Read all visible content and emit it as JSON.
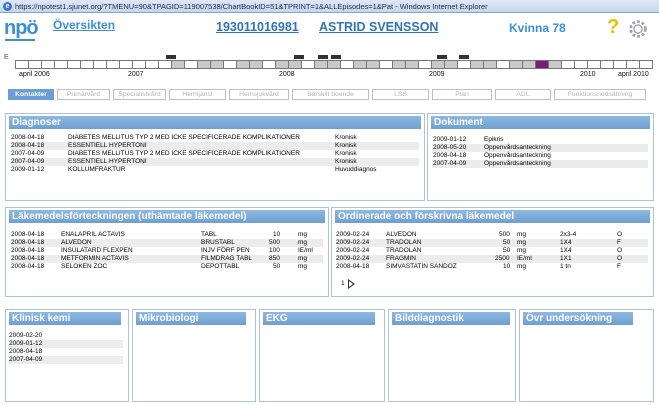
{
  "window": {
    "title": "https://npotest1.sjunet.org/?TMENU=90&TPAGID=119007538/ChartBookID=51&TPRINT=1&ALLEpisodes=1&Pat - Windows Internet Explorer"
  },
  "header": {
    "logo": "npö",
    "overview_link": "Översikten",
    "patient_id": "193011016981",
    "patient_name": "ASTRID SVENSSON",
    "gender_age": "Kvinna 78",
    "help_icon": "question-mark",
    "settings_icon": "gear"
  },
  "timeline": {
    "expand": "E",
    "years": [
      "april 2006",
      "2007",
      "2008",
      "2009",
      "2010",
      "april 2010"
    ],
    "highlight_color": "#7a1a7a"
  },
  "tabs": [
    {
      "label": "Kontakter",
      "active": true
    },
    {
      "label": "Primärvård",
      "active": false
    },
    {
      "label": "Specialistvård",
      "active": false
    },
    {
      "label": "Hemtjänst",
      "active": false
    },
    {
      "label": "Hemsjukvård",
      "active": false
    },
    {
      "label": "Särskilt boende",
      "active": false
    },
    {
      "label": "LSS",
      "active": false
    },
    {
      "label": "Plan",
      "active": false
    },
    {
      "label": "ADL",
      "active": false
    },
    {
      "label": "Funktionsnedsättning",
      "active": false
    }
  ],
  "diagnoser": {
    "title": "Diagnoser",
    "rows": [
      {
        "date": "2008-04-18",
        "text": "DIABETES MELLITUS TYP 2 MED ICKE SPECIFICERADE KOMPLIKATIONER",
        "type": "Kronisk"
      },
      {
        "date": "2008-04-18",
        "text": "ESSENTIELL HYPERTONI",
        "type": "Kronisk"
      },
      {
        "date": "2007-04-09",
        "text": "DIABETES MELLITUS TYP 2 MED ICKE SPECIFICERADE KOMPLIKATIONER",
        "type": "Kronisk"
      },
      {
        "date": "2007-04-09",
        "text": "ESSENTIELL HYPERTONI",
        "type": "Kronisk"
      },
      {
        "date": "2009-01-12",
        "text": "KOLLUMFRAKTUR",
        "type": "Huvuddiagnos"
      }
    ]
  },
  "dokument": {
    "title": "Dokument",
    "rows": [
      {
        "date": "2009-01-12",
        "text": "Epikris"
      },
      {
        "date": "2008-05-20",
        "text": "Oppenvårdsanteckning"
      },
      {
        "date": "2008-04-18",
        "text": "Oppenvårdsanteckning"
      },
      {
        "date": "2007-04-09",
        "text": "Oppenvårdsanteckning"
      }
    ]
  },
  "lakemedel": {
    "title": "Läkemedelsförteckningen (uthämtade läkemedel)",
    "rows": [
      {
        "date": "2008-04-18",
        "name": "ENALAPRIL ACTAVIS",
        "form": "TABL",
        "dose": "10",
        "unit": "mg"
      },
      {
        "date": "2008-04-18",
        "name": "ALVEDON",
        "form": "BRUSTABL",
        "dose": "500",
        "unit": "mg"
      },
      {
        "date": "2008-04-18",
        "name": "INSULATARD FLEXPEN",
        "form": "INJV FÖRF PEN",
        "dose": "100",
        "unit": "IE/ml"
      },
      {
        "date": "2008-04-18",
        "name": "METFORMIN ACTAVIS",
        "form": "FILMDRAG TABL",
        "dose": "850",
        "unit": "mg"
      },
      {
        "date": "2008-04-18",
        "name": "SELOKEN ZOC",
        "form": "DEPOTTABL",
        "dose": "50",
        "unit": "mg"
      }
    ]
  },
  "ordinerade": {
    "title": "Ordinerade och förskrivna läkemedel",
    "rows": [
      {
        "date": "2009-02-24",
        "name": "ALVEDON",
        "dose": "500",
        "unit": "mg",
        "freq": "2x3-4",
        "code": "O"
      },
      {
        "date": "2009-02-24",
        "name": "TRADOLAN",
        "dose": "50",
        "unit": "mg",
        "freq": "1X4",
        "code": "F"
      },
      {
        "date": "2009-02-24",
        "name": "TRADOLAN",
        "dose": "50",
        "unit": "mg",
        "freq": "1X4",
        "code": "O"
      },
      {
        "date": "2009-02-24",
        "name": "FRAGMIN",
        "dose": "2500",
        "unit": "IE/ml",
        "freq": "1X1",
        "code": "O"
      },
      {
        "date": "2008-04-18",
        "name": "SIMVASTATIN SANDOZ",
        "dose": "10",
        "unit": "mg",
        "freq": "1 tn",
        "code": "F"
      }
    ],
    "pager": "1"
  },
  "klinisk_kemi": {
    "title": "Klinisk kemi",
    "rows": [
      "2009-02-20",
      "2009-01-12",
      "2008-04-18",
      "2007-04-09"
    ]
  },
  "mikrobiologi": {
    "title": "Mikrobiologi"
  },
  "ekg": {
    "title": "EKG"
  },
  "bilddiagnostik": {
    "title": "Bilddiagnostik"
  },
  "ovr": {
    "title": "Övr undersökning"
  }
}
